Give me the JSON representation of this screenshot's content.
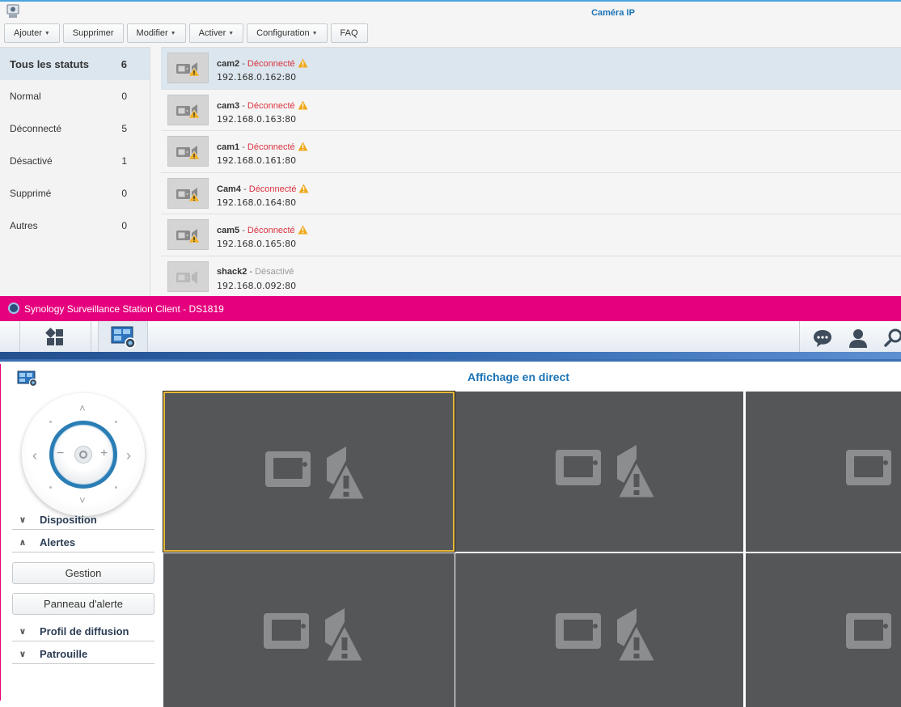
{
  "camera_window": {
    "title": "Caméra IP",
    "toolbar": [
      {
        "label": "Ajouter",
        "dropdown": true
      },
      {
        "label": "Supprimer",
        "dropdown": false
      },
      {
        "label": "Modifier",
        "dropdown": true
      },
      {
        "label": "Activer",
        "dropdown": true
      },
      {
        "label": "Configuration",
        "dropdown": true
      },
      {
        "label": "FAQ",
        "dropdown": false
      }
    ],
    "status_filters": [
      {
        "label": "Tous les statuts",
        "count": "6",
        "active": true
      },
      {
        "label": "Normal",
        "count": "0",
        "active": false
      },
      {
        "label": "Déconnecté",
        "count": "5",
        "active": false
      },
      {
        "label": "Désactivé",
        "count": "1",
        "active": false
      },
      {
        "label": "Supprimé",
        "count": "0",
        "active": false
      },
      {
        "label": "Autres",
        "count": "0",
        "active": false
      }
    ],
    "cameras": [
      {
        "name": "cam2",
        "status": "Déconnecté",
        "state": "disconnected",
        "ip": "192.168.0.162:80",
        "selected": true
      },
      {
        "name": "cam3",
        "status": "Déconnecté",
        "state": "disconnected",
        "ip": "192.168.0.163:80",
        "selected": false
      },
      {
        "name": "cam1",
        "status": "Déconnecté",
        "state": "disconnected",
        "ip": "192.168.0.161:80",
        "selected": false
      },
      {
        "name": "Cam4",
        "status": "Déconnecté",
        "state": "disconnected",
        "ip": "192.168.0.164:80",
        "selected": false
      },
      {
        "name": "cam5",
        "status": "Déconnecté",
        "state": "disconnected",
        "ip": "192.168.0.165:80",
        "selected": false
      },
      {
        "name": "shack2",
        "status": "Désactivé",
        "state": "disabled",
        "ip": "192.168.0.092:80",
        "selected": false
      }
    ],
    "separator": "-"
  },
  "surveillance_window": {
    "title": "Synology Surveillance Station Client - DS1819",
    "accent_color": "#e5007d",
    "taskbar_right_icons": [
      "chat-icon",
      "user-icon",
      "search-icon"
    ],
    "live_view_title": "Affichage en direct",
    "sections": {
      "disposition": "Disposition",
      "alertes": "Alertes",
      "profil": "Profil de diffusion",
      "patrouille": "Patrouille"
    },
    "buttons": {
      "gestion": "Gestion",
      "panneau": "Panneau d'alerte"
    },
    "ptz_symbols": {
      "up": "˄",
      "down": "˅",
      "left": "‹",
      "right": "›",
      "zoom_out": "−",
      "zoom_in": "+"
    },
    "live_tiles": [
      {
        "state": "disconnected",
        "selected": true
      },
      {
        "state": "disconnected",
        "selected": false
      },
      {
        "state": "disconnected",
        "selected": false
      },
      {
        "state": "disconnected",
        "selected": false
      },
      {
        "state": "disconnected",
        "selected": false
      },
      {
        "state": "disconnected",
        "selected": false
      }
    ]
  }
}
